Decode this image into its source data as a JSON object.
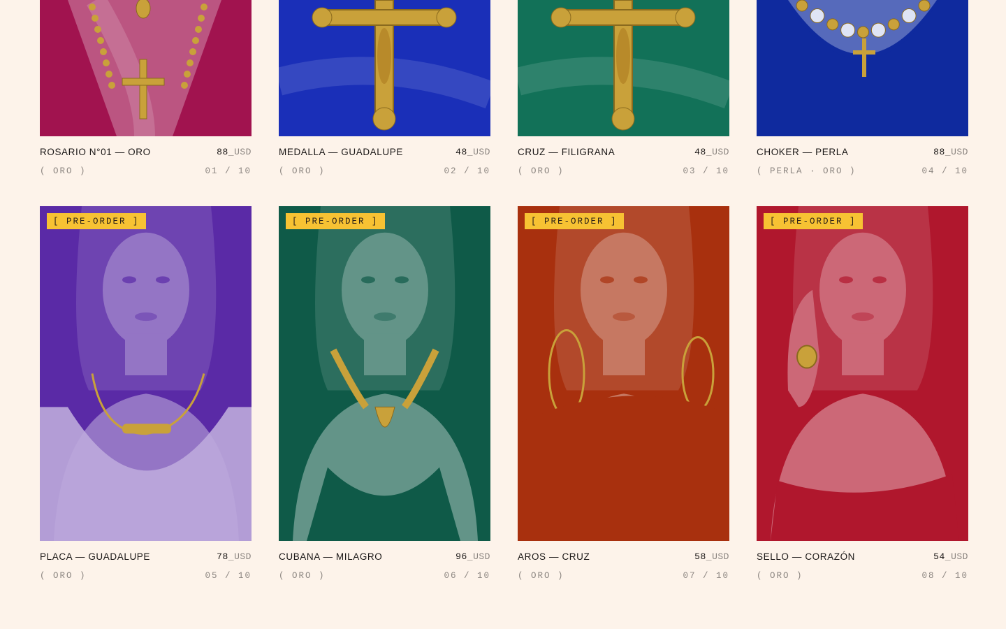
{
  "products": [
    {
      "name": "ROSARIO N°01 — ORO",
      "price": "88",
      "currency": "_USD",
      "material": "( ORO )",
      "index": "01 / 10",
      "badge": "",
      "tint": "#a1134f",
      "subject": "rosary"
    },
    {
      "name": "MEDALLA — GUADALUPE",
      "price": "48",
      "currency": "_USD",
      "material": "( ORO )",
      "index": "02 / 10",
      "badge": "",
      "tint": "#1a2fb8",
      "subject": "crucifix"
    },
    {
      "name": "CRUZ — FILIGRANA",
      "price": "48",
      "currency": "_USD",
      "material": "( ORO )",
      "index": "03 / 10",
      "badge": "",
      "tint": "#127158",
      "subject": "crucifix"
    },
    {
      "name": "CHOKER — PERLA",
      "price": "88",
      "currency": "_USD",
      "material": "( PERLA · ORO )",
      "index": "04 / 10",
      "badge": "",
      "tint": "#0f2a9e",
      "subject": "choker"
    },
    {
      "name": "PLACA — GUADALUPE",
      "price": "78",
      "currency": "_USD",
      "material": "( ORO )",
      "index": "05 / 10",
      "badge": "[ PRE-ORDER ]",
      "tint": "#5a2aa6",
      "subject": "portrait-necklace"
    },
    {
      "name": "CUBANA — MILAGRO",
      "price": "96",
      "currency": "_USD",
      "material": "( ORO )",
      "index": "06 / 10",
      "badge": "[ PRE-ORDER ]",
      "tint": "#0f5a48",
      "subject": "portrait-chain"
    },
    {
      "name": "AROS — CRUZ",
      "price": "58",
      "currency": "_USD",
      "material": "( ORO )",
      "index": "07 / 10",
      "badge": "[ PRE-ORDER ]",
      "tint": "#a8300e",
      "subject": "portrait-hoops"
    },
    {
      "name": "SELLO — CORAZÓN",
      "price": "54",
      "currency": "_USD",
      "material": "( ORO )",
      "index": "08 / 10",
      "badge": "[ PRE-ORDER ]",
      "tint": "#b0172d",
      "subject": "portrait-ring"
    }
  ]
}
